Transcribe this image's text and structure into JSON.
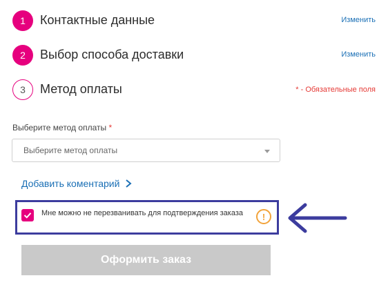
{
  "steps": [
    {
      "number": "1",
      "title": "Контактные данные",
      "link": "Изменить",
      "state": "done"
    },
    {
      "number": "2",
      "title": "Выбор способа доставки",
      "link": "Изменить",
      "state": "done"
    },
    {
      "number": "3",
      "title": "Метод оплаты",
      "state": "current"
    }
  ],
  "required_note": "* - Обязательные поля",
  "payment": {
    "label": "Выберите метод оплаты",
    "required_mark": "*",
    "select_value": "Выберите метод оплаты"
  },
  "comment": {
    "label": "Добавить коментарий"
  },
  "callback_option": {
    "checked": true,
    "label": "Мне можно не перезванивать для подтверждения заказа",
    "info_symbol": "!"
  },
  "submit": {
    "label": "Оформить заказ",
    "disabled": true
  },
  "colors": {
    "accent": "#e6007e",
    "link": "#1a6fb5",
    "required": "#e53935",
    "highlight": "#3c3c9e",
    "warning": "#f2a33a",
    "disabled_button": "#c9c9c9"
  }
}
